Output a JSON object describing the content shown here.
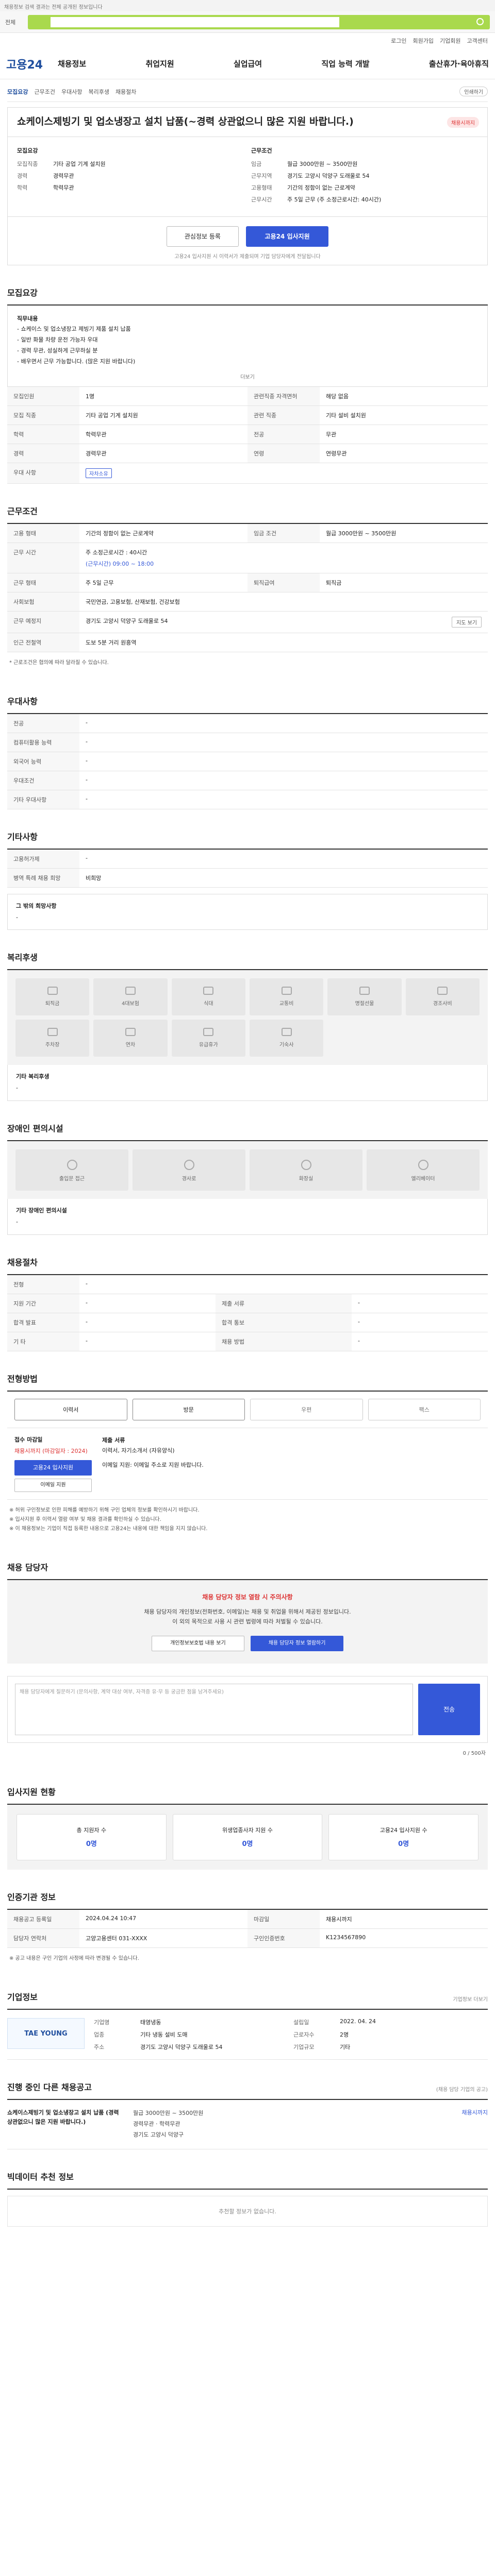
{
  "top": {
    "notice": "채용정보 검색 결과는 전체 공개된 정보입니다"
  },
  "search": {
    "category": "전체",
    "placeholder": "",
    "value": ""
  },
  "util": [
    "로그인",
    "회원가입",
    "기업회원",
    "고객센터"
  ],
  "nav": {
    "logo": "고용24",
    "menu": [
      "채용정보",
      "취업지원",
      "실업급여",
      "직업 능력 개발",
      "출산휴가·육아휴직"
    ]
  },
  "subhead": {
    "label": "모집요강",
    "items": [
      "근무조건",
      "우대사항",
      "복리후생",
      "채용절차"
    ],
    "right": "인쇄하기"
  },
  "job": {
    "title": "쇼케이스제빙기 및 업소냉장고 설치 납품(~경력 상관없으니 많은 지원 바랍니다.)",
    "badge": "채용시까지",
    "recruit_title": "모집요강",
    "work_title": "근무조건",
    "recruit": [
      {
        "k": "모집직종",
        "v": "기타 공업 기계 설치원"
      },
      {
        "k": "경력",
        "v": "경력무관"
      },
      {
        "k": "학력",
        "v": "학력무관"
      }
    ],
    "work": [
      {
        "k": "임금",
        "v": "월급 3000만원 ~ 3500만원"
      },
      {
        "k": "근무지역",
        "v": "경기도 고양시 덕양구 도래울로 54"
      },
      {
        "k": "고용형태",
        "v": "기간의 정함이 없는 근로계약"
      },
      {
        "k": "근무시간",
        "v": "주 5일 근무 (주 소정근로시간: 40시간)"
      }
    ]
  },
  "actions": {
    "favorite": "관심정보 등록",
    "apply": "고용24 입사지원",
    "note": "고용24 입사지원 시 이력서가 제출되며 기업 담당자에게 전달됩니다"
  },
  "desc": {
    "title": "모집요강",
    "lines": [
      "직무내용",
      "- 쇼케이스 및 업소냉장고 제빙기 제품 설치 납품",
      "- 일반 화물 차량 운전 가능자 우대",
      "- 경력 무관, 성실하게 근무하실 분",
      "- 배우면서 근무 가능합니다. (많은 지원 바랍니다)"
    ],
    "more": "더보기"
  },
  "recruit_table": [
    [
      "모집인원",
      "1명",
      "관련직종 자격면허",
      "해당 없음"
    ],
    [
      "모집 직종",
      "기타 공업 기계 설치원",
      "관련 직종",
      "기타 설비 설치원"
    ],
    [
      "학력",
      "학력무관",
      "전공",
      "무관"
    ],
    [
      "경력",
      "경력무관",
      "연령",
      "연령무관"
    ],
    [
      "우대 사항",
      "자차소유",
      "",
      ""
    ]
  ],
  "work_cond": {
    "title": "근무조건",
    "employ_k": "고용 형태",
    "employ_v": "기간의 정함이 없는 근로계약",
    "wage_k": "임금 조건",
    "wage_v": "월급 3000만원 ~ 3500만원",
    "hours_k": "근무 시간",
    "hours_v": "주 소정근로시간 : 40시간",
    "hours_sub": "(근무시간) 09:00 ~ 18:00",
    "worktype_k": "근무 형태",
    "worktype_v": "주 5일 근무",
    "insure_k": "사회보험",
    "insure_v": "국민연금, 고용보험, 산재보험, 건강보험",
    "retire_k": "퇴직급여",
    "retire_v": "퇴직금",
    "place_k": "근무 예정지",
    "place_v": "경기도 고양시 덕양구 도래울로 54",
    "station_k": "인근 전철역",
    "station_v": "도보 5분 거리 원흥역",
    "map_btn": "지도 보기",
    "note": "* 근로조건은 협의에 따라 달라질 수 있습니다."
  },
  "prefer": {
    "title": "우대사항",
    "rows": [
      [
        "전공",
        "-"
      ],
      [
        "컴퓨터활용 능력",
        "-"
      ],
      [
        "외국어 능력",
        "-"
      ],
      [
        "우대조건",
        "-"
      ],
      [
        "기타 우대사항",
        "-"
      ]
    ]
  },
  "extra": {
    "title": "기타사항",
    "rows": [
      [
        "고용허가제",
        "-"
      ],
      [
        "병역 특례 채용 희망",
        "비희망"
      ]
    ],
    "sub_title": "그 밖의 희망사항",
    "sub_value": "-"
  },
  "benefits": {
    "title": "복리후생",
    "items": [
      "퇴직금",
      "4대보험",
      "식대",
      "교통비",
      "명절선물",
      "경조사비",
      "주차장",
      "연차",
      "유급휴가",
      "기숙사"
    ],
    "etc_title": "기타 복리후생",
    "etc_value": "-"
  },
  "disability": {
    "title": "장애인 편의시설",
    "items": [
      "출입문 접근",
      "경사로",
      "화장실",
      "엘리베이터"
    ],
    "etc_title": "기타 장애인 편의시설",
    "etc_value": "-"
  },
  "process": {
    "title": "채용절차",
    "rows": [
      [
        "전형",
        "-",
        "",
        ""
      ],
      [
        "지원 기간",
        "-",
        "제출 서류",
        "-"
      ],
      [
        "합격 발표",
        "-",
        "합격 통보",
        "-"
      ],
      [
        "기 타",
        "-",
        "채용 방법",
        "-"
      ]
    ]
  },
  "apply": {
    "title": "전형방법",
    "methods": [
      "이력서",
      "방문",
      "우편",
      "팩스"
    ],
    "period_label": "접수 마감일",
    "period_value": "채용시까지 (마감일자 : 2024)",
    "apply_btn": "고용24 입사지원",
    "email_btn": "이메일 지원",
    "doc_title": "제출 서류",
    "doc_value": "이력서, 자기소개서 (자유양식)",
    "contact": "이메일 지원: 이메일 주소로 지원 바랍니다.",
    "bullets": [
      "※ 허위 구인정보로 인한 피해를 예방하기 위해 구인 업체의 정보를 확인하시기 바랍니다.",
      "※ 입사지원 후 이력서 열람 여부 및 채용 결과를 확인하실 수 있습니다.",
      "※ 이 채용정보는 기업이 직접 등록한 내용으로 고용24는 내용에 대한 책임을 지지 않습니다."
    ]
  },
  "contact": {
    "title": "채용 담당자",
    "warn": "채용 담당자 정보 열람 시 주의사항",
    "lines": [
      "채용 담당자의 개인정보(전화번호, 이메일)는 채용 및 취업을 위해서 제공된 정보입니다.",
      "이 외의 목적으로 사용 시 관련 법령에 따라 처벌될 수 있습니다."
    ],
    "btn1": "개인정보보호법 내용 보기",
    "btn2": "채용 담당자 정보 열람하기",
    "ask_placeholder": "채용 담당자에게 질문하기 (문의사항, 계약 대상 여부, 자격증 유·무 등 궁금한 점을 남겨주세요)",
    "ask_btn": "전송",
    "ask_note": "0 / 500자"
  },
  "stats": {
    "title": "입사지원 현황",
    "items": [
      {
        "label": "총 지원자 수",
        "value": "0명"
      },
      {
        "label": "위생업종사자 지원 수",
        "value": "0명"
      },
      {
        "label": "고용24 입사지원 수",
        "value": "0명"
      }
    ]
  },
  "reg": {
    "title": "인증기관 정보",
    "rows": [
      [
        "채용공고 등록일",
        "2024.04.24 10:47",
        "마감일",
        "채용시까지"
      ],
      [
        "담당자 연락처",
        "고양고용센터 031-XXXX",
        "구인인증번호",
        "K1234567890"
      ]
    ],
    "note": "※ 공고 내용은 구인 기업의 사정에 따라 변경될 수 있습니다."
  },
  "company": {
    "title": "기업정보",
    "logo": "TAE YOUNG",
    "rows": [
      [
        "기업명",
        "태영냉동",
        "설립일",
        "2022. 04. 24"
      ],
      [
        "업종",
        "기타 냉동 설비 도매",
        "근로자수",
        "2명"
      ],
      [
        "주소",
        "경기도 고양시 덕양구 도래울로 54",
        "기업규모",
        "기타"
      ]
    ],
    "more": "기업정보 더보기"
  },
  "other": {
    "title": "진행 중인 다른 채용공고",
    "title_small": "(채용 담당 기업의 공고)",
    "item": {
      "t": "쇼케이스제빙기 및 업소냉장고 설치 납품 (경력 상관없으니 많은 지원 바랍니다.)",
      "m": [
        "월급 3000만원 ~ 3500만원",
        "경력무관 · 학력무관",
        "경기도 고양시 덕양구"
      ],
      "r": "채용시까지"
    }
  },
  "recommend": {
    "title": "빅데이터 추천 정보",
    "empty": "추천할 정보가 없습니다."
  }
}
